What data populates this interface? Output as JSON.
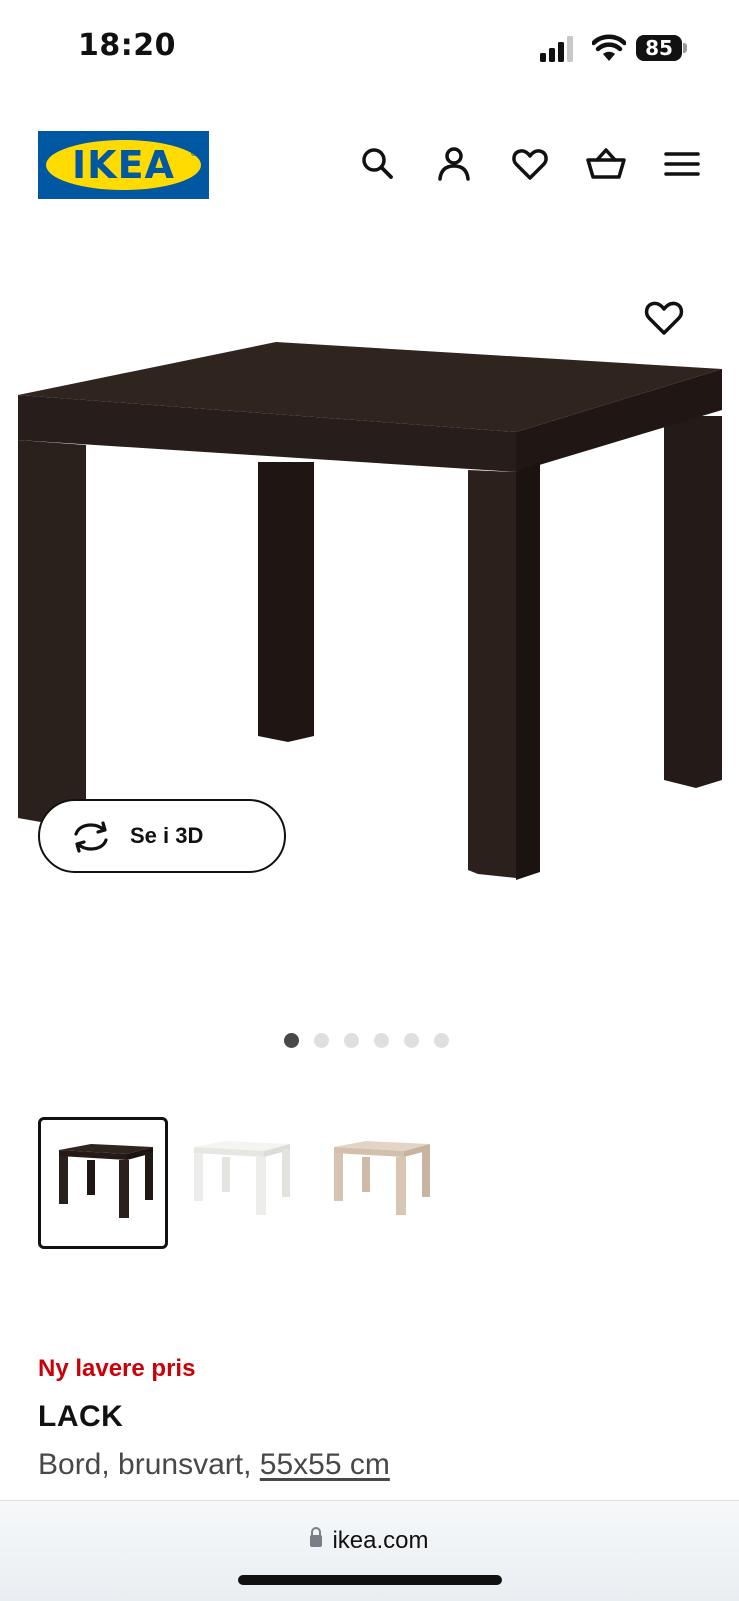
{
  "status_bar": {
    "time": "18:20",
    "battery": "85",
    "icons": [
      "signal-icon",
      "wifi-icon",
      "battery-icon"
    ]
  },
  "header": {
    "logo_text": "IKEA",
    "logo_mark": "®",
    "icons": [
      "search-icon",
      "account-icon",
      "heart-icon",
      "basket-icon",
      "menu-icon"
    ]
  },
  "product_image": {
    "favorite_icon": "heart-icon",
    "view_3d_label": "Se i 3D",
    "view_3d_icon": "rotate-icon"
  },
  "carousel": {
    "dot_count": 6,
    "active_index": 0
  },
  "variants": [
    {
      "color_name": "brunsvart",
      "hex": "#2b201c",
      "selected": true
    },
    {
      "color_name": "white",
      "hex": "#f4f4f2",
      "selected": false
    },
    {
      "color_name": "white-stained oak",
      "hex": "#d8c6b3",
      "selected": false
    }
  ],
  "product": {
    "price_tag": "Ny lavere pris",
    "name": "LACK",
    "desc_prefix": "Bord, brunsvart, ",
    "size": "55x55 cm"
  },
  "browser": {
    "url": "ikea.com"
  },
  "colors": {
    "brand_blue": "#0058a3",
    "brand_yellow": "#ffdb00",
    "price_red": "#cc0008",
    "table_dark": "#2b201c"
  }
}
